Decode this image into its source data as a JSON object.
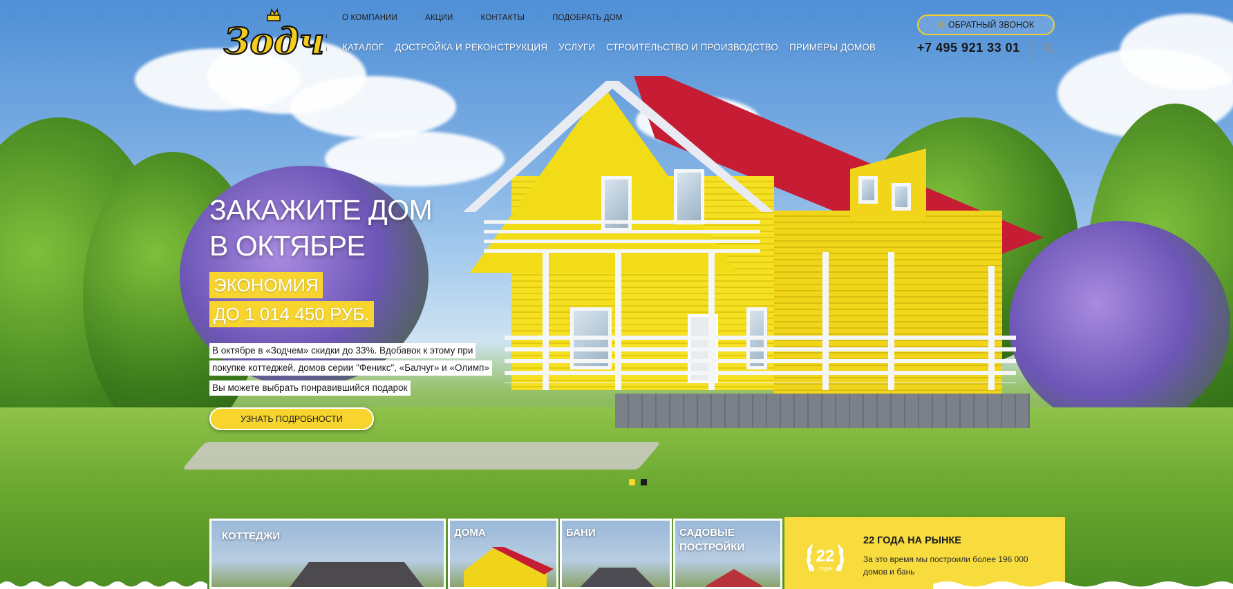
{
  "logo": {
    "text": "Зодчий",
    "icon": "logo-emblem"
  },
  "top_nav": [
    {
      "label": "О КОМПАНИИ"
    },
    {
      "label": "АКЦИИ"
    },
    {
      "label": "КОНТАКТЫ"
    },
    {
      "label": "ПОДОБРАТЬ ДОМ"
    }
  ],
  "main_nav": [
    {
      "label": "КАТАЛОГ"
    },
    {
      "label": "ДОСТРОЙКА И РЕКОНСТРУКЦИЯ"
    },
    {
      "label": "УСЛУГИ"
    },
    {
      "label": "СТРОИТЕЛЬСТВО И ПРОИЗВОДСТВО"
    },
    {
      "label": "ПРИМЕРЫ ДОМОВ"
    }
  ],
  "header": {
    "callback_label": "ОБРАТНЫЙ ЗВОНОК",
    "callback_icon": "phone-icon",
    "phone": "+7 495 921 33 01",
    "search_icon": "search-icon"
  },
  "hero": {
    "title_line1": "ЗАКАЖИТЕ ДОМ",
    "title_line2": "В ОКТЯБРЕ",
    "highlight_line1": "ЭКОНОМИЯ",
    "highlight_line2": "ДО 1 014 450 РУБ.",
    "desc_line1": "В октябре в «Зодчем» скидки до 33%. Вдобавок к этому при",
    "desc_line2": "покупке коттеджей, домов серии \"Феникс\", «Балчуг» и «Олимп»",
    "desc_line3": "Вы можете выбрать понравившийся подарок",
    "cta_label": "УЗНАТЬ ПОДРОБНОСТИ",
    "slides_total": 2,
    "active_slide": 1
  },
  "categories": [
    {
      "label": "КОТТЕДЖИ"
    },
    {
      "label": "ДОМА"
    },
    {
      "label": "БАНИ"
    },
    {
      "label_line1": "САДОВЫЕ",
      "label_line2": "ПОСТРОЙКИ"
    }
  ],
  "info": {
    "badge_number": "22",
    "badge_word": "года",
    "title": "22 ГОДА НА РЫНКЕ",
    "text_line1": "За это время мы построили более 196 000",
    "text_line2": "домов и бань"
  },
  "colors": {
    "accent_yellow": "#f7d52e",
    "roof_red": "#c61d35",
    "text_dark": "#1c1c1c"
  }
}
